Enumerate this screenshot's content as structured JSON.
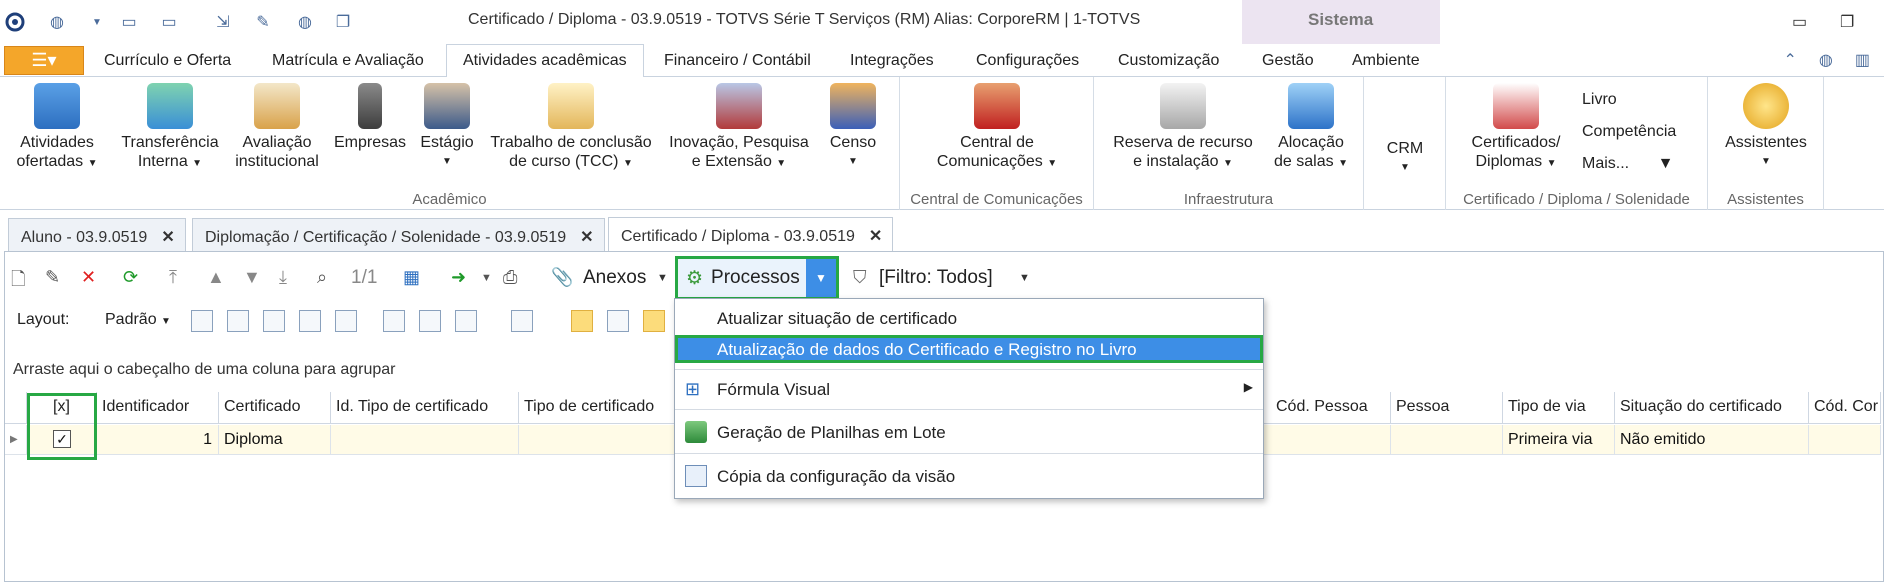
{
  "window": {
    "title": "Certificado / Diploma - 03.9.0519 - TOTVS Série T Serviços (RM) Alias: CorporeRM | 1-TOTVS",
    "context_tab": "Sistema"
  },
  "menubar": {
    "tabs": [
      "Currículo e Oferta",
      "Matrícula e Avaliação",
      "Atividades acadêmicas",
      "Financeiro / Contábil",
      "Integrações",
      "Configurações",
      "Customização",
      "Gestão",
      "Ambiente"
    ],
    "active_tab": "Atividades acadêmicas"
  },
  "ribbon": {
    "groups": {
      "academico": "Acadêmico",
      "comunicacoes": "Central de Comunicações",
      "infra": "Infraestrutura",
      "certificado": "Certificado / Diploma / Solenidade",
      "assistentes": "Assistentes"
    },
    "buttons": {
      "atividades": [
        "Atividades",
        "ofertadas"
      ],
      "transferencia": [
        "Transferência",
        "Interna"
      ],
      "avaliacao": [
        "Avaliação",
        "institucional"
      ],
      "empresas": "Empresas",
      "estagio": "Estágio",
      "tcc": [
        "Trabalho de conclusão",
        "de curso (TCC)"
      ],
      "inovacao": [
        "Inovação, Pesquisa",
        "e Extensão"
      ],
      "censo": "Censo",
      "central": [
        "Central de",
        "Comunicações"
      ],
      "reserva": [
        "Reserva de recurso",
        "e instalação"
      ],
      "alocacao": [
        "Alocação",
        "de salas"
      ],
      "crm": "CRM",
      "certificados": [
        "Certificados/",
        "Diplomas"
      ],
      "livro": "Livro",
      "competencia": "Competência",
      "mais": "Mais...",
      "assistentes": "Assistentes"
    }
  },
  "doctabs": [
    "Aluno - 03.9.0519",
    "Diplomação / Certificação / Solenidade - 03.9.0519",
    "Certificado / Diploma - 03.9.0519"
  ],
  "toolbar": {
    "paging": "1/1",
    "anexos": "Anexos",
    "processos": "Processos",
    "filtro": "[Filtro: Todos]",
    "layout": "Layout:",
    "padrao": "Padrão"
  },
  "grid": {
    "group_hint": "Arraste aqui o cabeçalho de uma coluna para agrupar",
    "columns": [
      "[x]",
      "Identificador",
      "Certificado",
      "Id. Tipo de certificado",
      "Tipo de certificado",
      "Cód. Pessoa",
      "Pessoa",
      "Tipo de via",
      "Situação do certificado",
      "Cód. Cor"
    ],
    "row": {
      "identificador": "1",
      "certificado": "Diploma",
      "tipo_via": "Primeira via",
      "situacao": "Não emitido",
      "checked": true
    }
  },
  "menu": {
    "items": [
      "Atualizar situação de certificado",
      "Atualização de dados do Certificado e Registro no Livro",
      "Fórmula Visual",
      "Geração de Planilhas em Lote",
      "Cópia da configuração da visão"
    ]
  },
  "colors": {
    "highlight": "#27a844",
    "selection": "#3d8ee6",
    "file_button": "#f4a62a"
  }
}
